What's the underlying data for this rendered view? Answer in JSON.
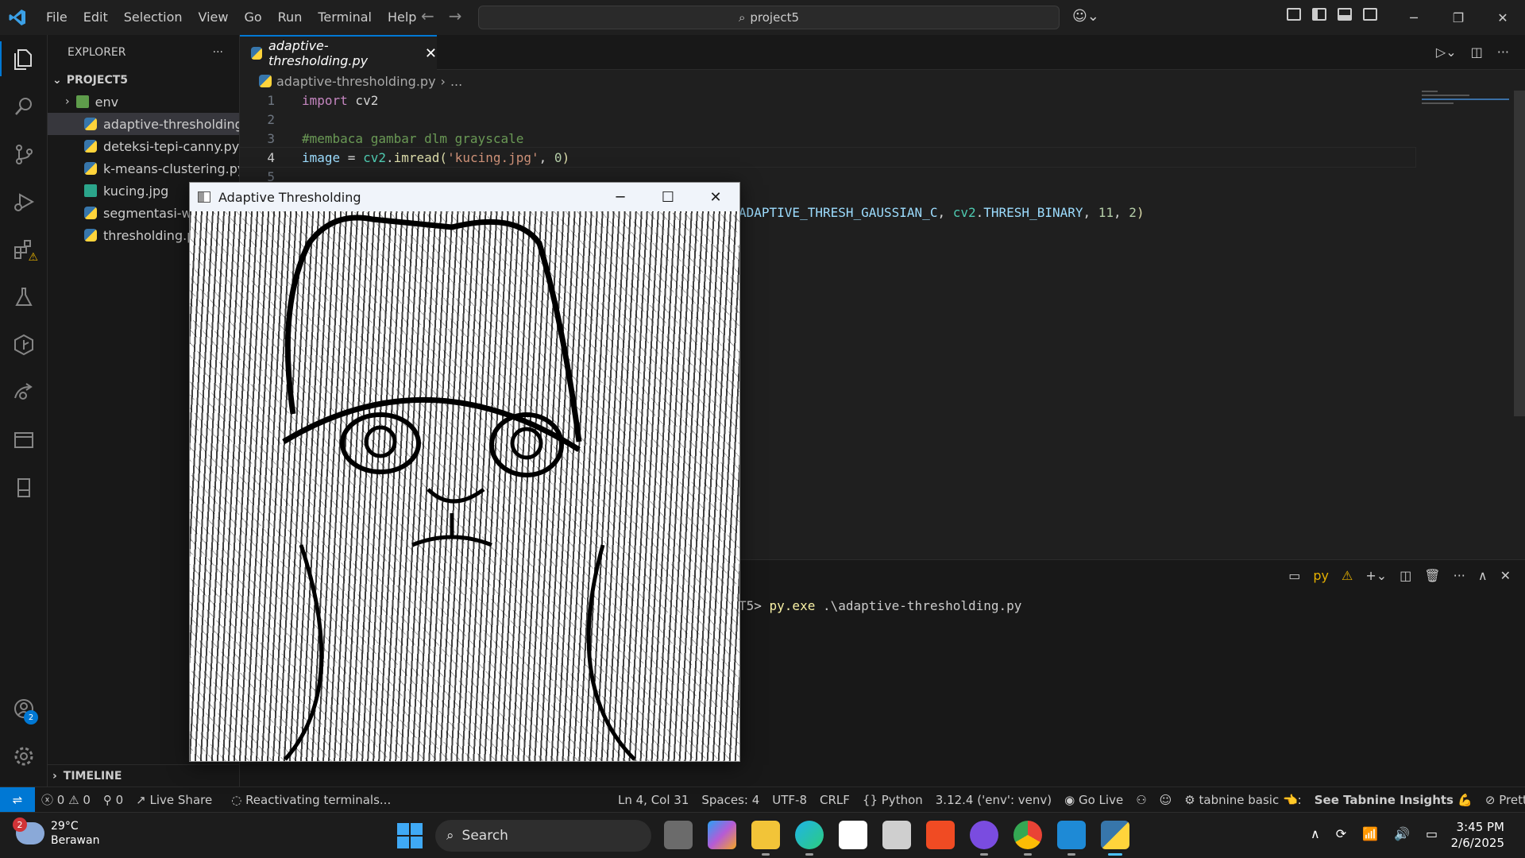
{
  "titlebar": {
    "menu": [
      "File",
      "Edit",
      "Selection",
      "View",
      "Go",
      "Run",
      "Terminal",
      "Help"
    ],
    "search": "project5"
  },
  "activitybar": {
    "icons": [
      "explorer-icon",
      "search-icon",
      "source-control-icon",
      "run-debug-icon",
      "extensions-icon",
      "testing-icon",
      "gitlens-icon",
      "remote-explorer-icon",
      "panel-icon",
      "notebook-icon",
      "accounts-icon",
      "settings-icon"
    ],
    "accounts_badge": "2"
  },
  "sidebar": {
    "title": "EXPLORER",
    "project": "PROJECT5",
    "items": [
      {
        "label": "env",
        "type": "folder"
      },
      {
        "label": "adaptive-thresholding.py",
        "type": "py",
        "selected": true
      },
      {
        "label": "deteksi-tepi-canny.py",
        "type": "py"
      },
      {
        "label": "k-means-clustering.py",
        "type": "py"
      },
      {
        "label": "kucing.jpg",
        "type": "img"
      },
      {
        "label": "segmentasi-watershed.py",
        "type": "py"
      },
      {
        "label": "thresholding.py",
        "type": "py"
      }
    ],
    "timeline": "TIMELINE"
  },
  "editor": {
    "tab": "adaptive-thresholding.py",
    "breadcrumb_file": "adaptive-thresholding.py",
    "breadcrumb_more": "...",
    "lines": [
      "1",
      "2",
      "3",
      "4",
      "5"
    ],
    "code": {
      "l1_kw": "import",
      "l1_mod": " cv2",
      "l3_comment": "#membaca gambar dlm grayscale",
      "l4_var": "image",
      "l4_eq": " = ",
      "l4_mod": "cv2",
      "l4_dot": ".",
      "l4_fn": "imread",
      "l4_open": "(",
      "l4_str": "'kucing.jpg'",
      "l4_comma": ", ",
      "l4_num": "0",
      "l4_close": ")",
      "l7_a": "ADAPTIVE_THRESH_GAUSSIAN_C",
      "l7_b": ", ",
      "l7_c": "cv2",
      "l7_d": ".",
      "l7_e": "THRESH_BINARY",
      "l7_f": ", ",
      "l7_g": "11",
      "l7_h": ", ",
      "l7_i": "2",
      "l7_j": ")"
    }
  },
  "terminal": {
    "profile": "py",
    "prompt_tail": "T5> ",
    "command": "py.exe",
    "args": " .\\adaptive-thresholding.py"
  },
  "popup": {
    "title": "Adaptive Thresholding"
  },
  "statusbar": {
    "errors": "0",
    "warnings": "0",
    "ports": "0",
    "live_share": "Live Share",
    "task": "Reactivating terminals...",
    "position": "Ln 4, Col 31",
    "spaces": "Spaces: 4",
    "encoding": "UTF-8",
    "eol": "CRLF",
    "language": "Python",
    "interpreter": "3.12.4 ('env': venv)",
    "go_live": "Go Live",
    "tabnine": "tabnine basic 👈:",
    "tabnine_insights": "See Tabnine Insights 💪",
    "prettier": "Prettier"
  },
  "taskbar": {
    "temp": "29°C",
    "weather": "Berawan",
    "weather_badge": "2",
    "search": "Search",
    "time": "3:45 PM",
    "date": "2/6/2025",
    "apps": [
      "task-view-icon",
      "copilot-icon",
      "file-explorer-icon",
      "edge-icon",
      "store-icon",
      "app-icon",
      "brave-icon",
      "github-desktop-icon",
      "chrome-icon",
      "vscode-icon",
      "python-icon"
    ]
  }
}
